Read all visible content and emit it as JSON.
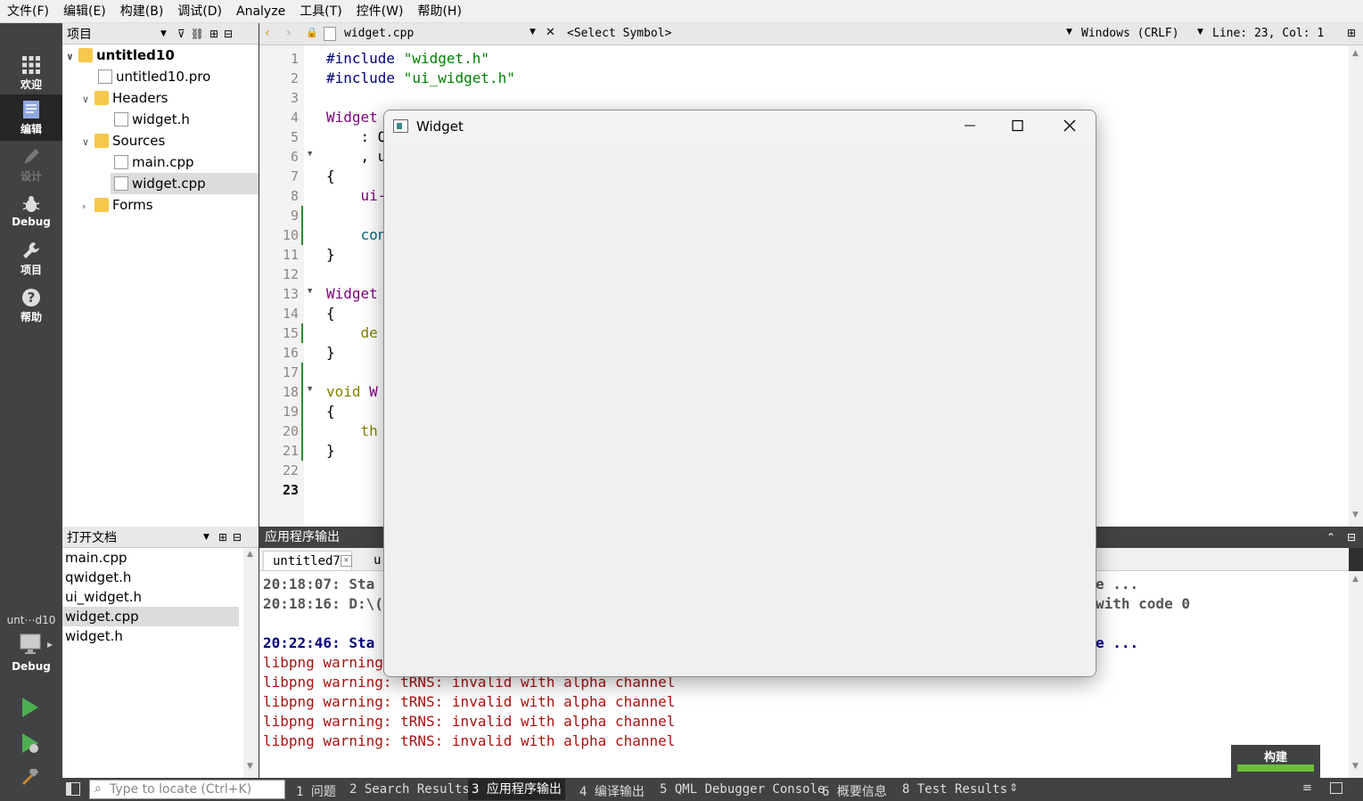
{
  "menubar": {
    "items": [
      "文件(F)",
      "编辑(E)",
      "构建(B)",
      "调试(D)",
      "Analyze",
      "工具(T)",
      "控件(W)",
      "帮助(H)"
    ]
  },
  "modebar": {
    "modes": [
      {
        "label": "欢迎",
        "icon": "grid-icon"
      },
      {
        "label": "编辑",
        "icon": "edit-icon"
      },
      {
        "label": "设计",
        "icon": "pencil-icon"
      },
      {
        "label": "Debug",
        "icon": "bug-icon"
      },
      {
        "label": "项目",
        "icon": "wrench-icon"
      },
      {
        "label": "帮助",
        "icon": "help-icon"
      }
    ],
    "kit_label": "unt⋯d10",
    "kit_mode": "Debug"
  },
  "project": {
    "header": "项目",
    "tree": [
      {
        "label": "untitled10"
      },
      {
        "label": "untitled10.pro"
      },
      {
        "label": "Headers"
      },
      {
        "label": "widget.h"
      },
      {
        "label": "Sources"
      },
      {
        "label": "main.cpp"
      },
      {
        "label": "widget.cpp"
      },
      {
        "label": "Forms"
      }
    ]
  },
  "open_docs": {
    "header": "打开文档",
    "items": [
      "main.cpp",
      "qwidget.h",
      "ui_widget.h",
      "widget.cpp",
      "widget.h"
    ]
  },
  "editor": {
    "file": "widget.cpp",
    "symbol": "<Select Symbol>",
    "encoding": "Windows (CRLF)",
    "position": "Line: 23, Col: 1",
    "line_numbers": [
      "1",
      "2",
      "3",
      "4",
      "5",
      "6",
      "7",
      "8",
      "9",
      "10",
      "11",
      "12",
      "13",
      "14",
      "15",
      "16",
      "17",
      "18",
      "19",
      "20",
      "21",
      "22",
      "23"
    ],
    "code": {
      "l1a": "#include ",
      "l1b": "\"widget.h\"",
      "l2a": "#include ",
      "l2b": "\"ui_widget.h\"",
      "l4": "Widget",
      "l5": "    : Q",
      "l6": "    , u",
      "l7": "{",
      "l8": "    ui-",
      "l10": "    con",
      "l11": "}",
      "l13": "Widget",
      "l14": "{",
      "l15": "    de",
      "l16": "}",
      "l18a": "void ",
      "l18b": "W",
      "l19": "{",
      "l20": "    th",
      "l21": "}"
    }
  },
  "output": {
    "header": "应用程序输出",
    "tabs": [
      "untitled7",
      "u"
    ],
    "lines": [
      {
        "left": "20:18:07: Sta",
        "right": "e ..."
      },
      {
        "left": "20:18:16: D:\\(",
        "right": "with code 0"
      },
      {
        "left": "20:22:46: Sta",
        "right": "e ..."
      },
      {
        "left": "libpng warning"
      },
      {
        "left": "libpng warning: tRNS: invalid with alpha channel"
      },
      {
        "left": "libpng warning: tRNS: invalid with alpha channel"
      },
      {
        "left": "libpng warning: tRNS: invalid with alpha channel"
      },
      {
        "left": "libpng warning: tRNS: invalid with alpha channel"
      }
    ]
  },
  "build_progress": {
    "label": "构建",
    "progress": 1.0
  },
  "statusbar": {
    "locate_placeholder": "Type to locate (Ctrl+K)",
    "tabs": [
      "1 问题",
      "2 Search Results",
      "3 应用程序输出",
      "4 编译输出",
      "5 QML Debugger Console",
      "6 概要信息",
      "8 Test Results"
    ]
  },
  "widget_window": {
    "title": "Widget"
  }
}
